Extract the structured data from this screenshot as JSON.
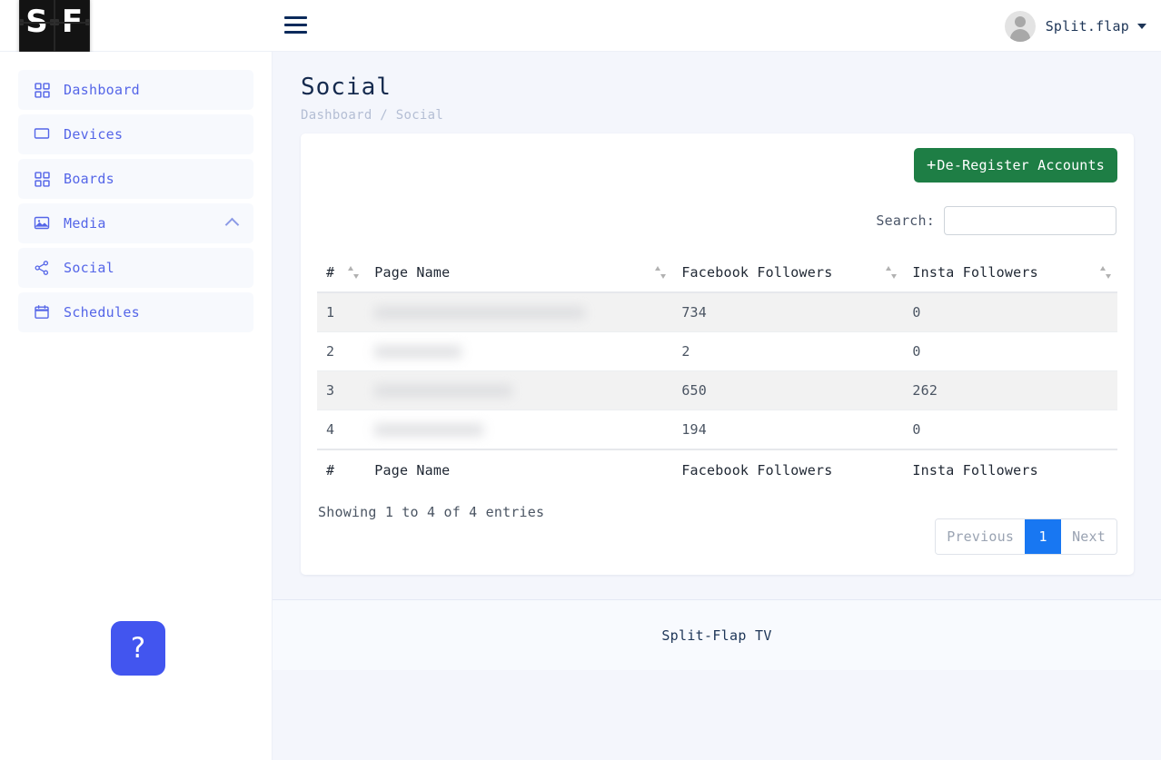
{
  "brand": {
    "logo_left": "S",
    "logo_right": "F",
    "name": "Split-Flap TV"
  },
  "topbar": {
    "menu_icon": "hamburger-icon",
    "user_name": "Split.flap",
    "caret_icon": "chevron-down-icon"
  },
  "sidebar": {
    "items": [
      {
        "label": "Dashboard",
        "icon": "grid-icon"
      },
      {
        "label": "Devices",
        "icon": "monitor-icon"
      },
      {
        "label": "Boards",
        "icon": "grid-icon"
      },
      {
        "label": "Media",
        "icon": "image-icon",
        "chevron": "chevron-up-icon"
      },
      {
        "label": "Social",
        "icon": "share-icon"
      },
      {
        "label": "Schedules",
        "icon": "calendar-icon"
      }
    ]
  },
  "page": {
    "title": "Social",
    "breadcrumb": "Dashboard / Social"
  },
  "toolbar": {
    "deregister_label": "De-Register Accounts",
    "deregister_plus": "+",
    "accent_green": "#1e7e45"
  },
  "search": {
    "label": "Search:",
    "value": "",
    "placeholder": ""
  },
  "table": {
    "columns": [
      "#",
      "Page Name",
      "Facebook Followers",
      "Insta Followers"
    ],
    "rows": [
      {
        "index": "1",
        "page_name": "",
        "facebook_followers": "734",
        "insta_followers": "0"
      },
      {
        "index": "2",
        "page_name": "",
        "facebook_followers": "2",
        "insta_followers": "0"
      },
      {
        "index": "3",
        "page_name": "",
        "facebook_followers": "650",
        "insta_followers": "262"
      },
      {
        "index": "4",
        "page_name": "",
        "facebook_followers": "194",
        "insta_followers": "0"
      }
    ],
    "info": "Showing 1 to 4 of 4 entries"
  },
  "pagination": {
    "previous": "Previous",
    "current": "1",
    "next": "Next",
    "active_color": "#1877f2"
  },
  "footer": {
    "text": "Split-Flap TV"
  },
  "help": {
    "glyph": "?",
    "color": "#4255ef"
  }
}
